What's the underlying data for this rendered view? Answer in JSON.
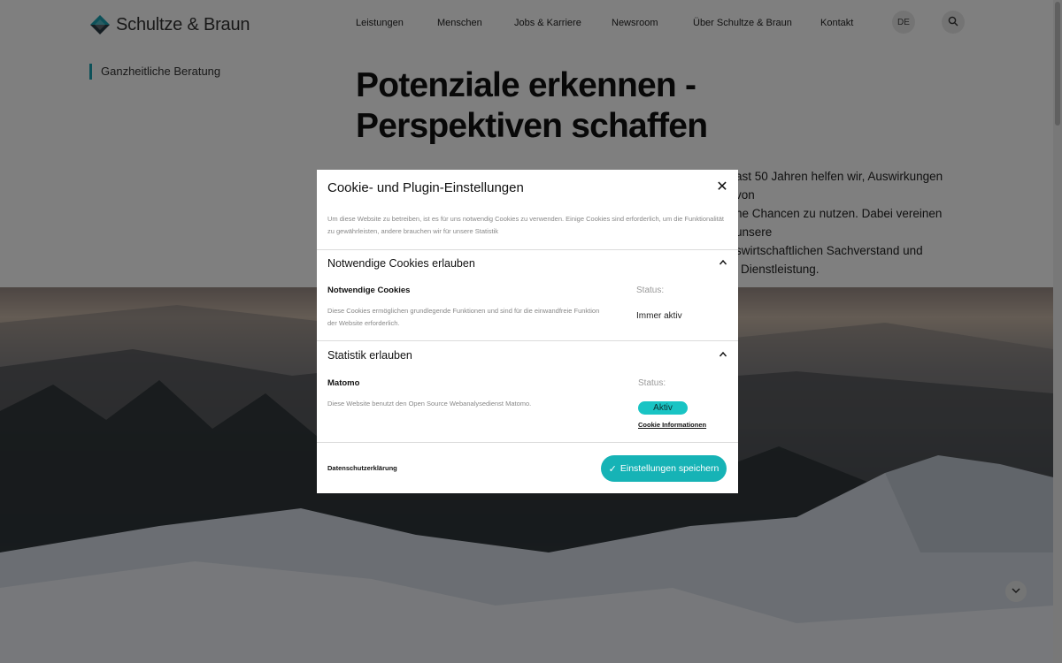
{
  "header": {
    "logo_text": "Schultze & Braun",
    "nav": [
      {
        "label": "Leistungen"
      },
      {
        "label": "Menschen"
      },
      {
        "label": "Jobs & Karriere"
      },
      {
        "label": "Newsroom"
      },
      {
        "label": "Über Schultze & Braun"
      },
      {
        "label": "Kontakt"
      }
    ],
    "language": "DE"
  },
  "sidebar": {
    "label": "Ganzheitliche Beratung"
  },
  "hero": {
    "title_line1": "Potenziale erkennen -",
    "title_line2": "Perspektiven schaffen",
    "text_line1": "ast 50 Jahren helfen wir, Auswirkungen von",
    "text_line2": "ne Chancen zu nutzen. Dabei vereinen unsere",
    "text_line3": "swirtschaftlichen Sachverstand und",
    "text_line4": "Dienstleistung."
  },
  "modal": {
    "title": "Cookie- und Plugin-Einstellungen",
    "intro": "Um diese Website zu betreiben, ist es für uns notwendig Cookies zu verwenden. Einige Cookies sind erforderlich, um die Funktionalität zu gewährleisten, andere brauchen wir für unsere Statistik",
    "sections": [
      {
        "title": "Notwendige Cookies erlauben",
        "item_name": "Notwendige Cookies",
        "item_desc": "Diese Cookies ermöglichen grundlegende Funktionen und sind für die einwandfreie Funktion der Website erforderlich.",
        "status_label": "Status:",
        "status_value": "Immer aktiv"
      },
      {
        "title": "Statistik erlauben",
        "item_name": "Matomo",
        "item_desc": "Diese Website benutzt den Open Source Webanalysedienst Matomo.",
        "status_label": "Status:",
        "status_value": "Aktiv",
        "info_link": "Cookie Informationen"
      }
    ],
    "privacy_link": "Datenschutzerklärung",
    "save_button": "Einstellungen speichern"
  },
  "colors": {
    "accent": "#16b3b6",
    "badge": "#19c4c4",
    "overlay": "rgba(0,0,0,0.5)"
  }
}
